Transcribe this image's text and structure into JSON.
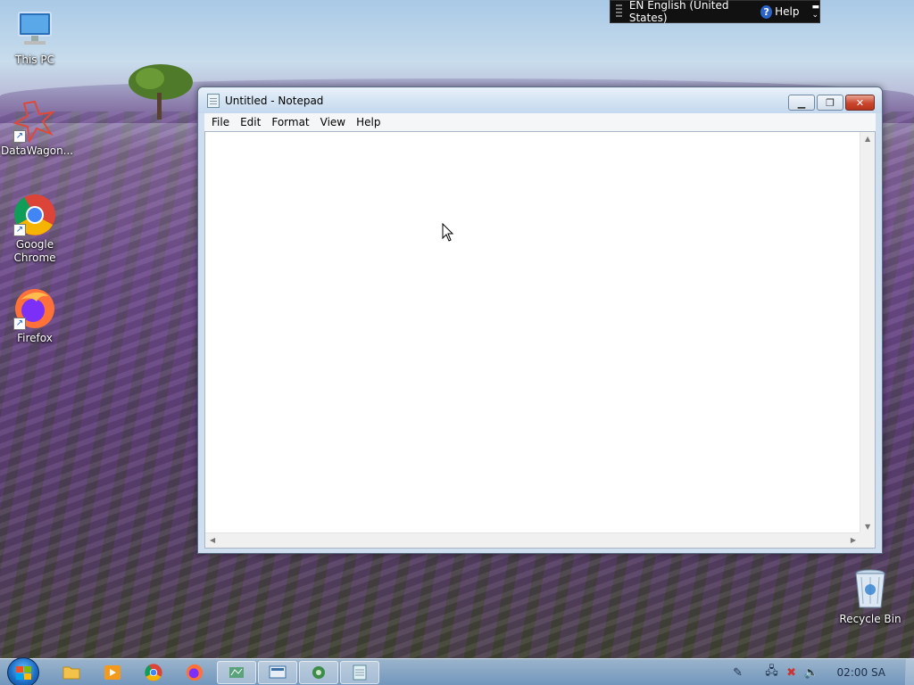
{
  "desktop": {
    "icons": [
      {
        "label": "This PC",
        "icon": "computer-icon"
      },
      {
        "label": "DataWagon...",
        "icon": "datawagon-icon"
      },
      {
        "label": "Google Chrome",
        "icon": "chrome-icon"
      },
      {
        "label": "Firefox",
        "icon": "firefox-icon"
      },
      {
        "label": "Recycle Bin",
        "icon": "recycle-bin-icon"
      }
    ]
  },
  "language_bar": {
    "language": "EN English (United States)",
    "help_label": "Help",
    "help_glyph": "?"
  },
  "notepad": {
    "title": "Untitled - Notepad",
    "menu": [
      "File",
      "Edit",
      "Format",
      "View",
      "Help"
    ],
    "content": ""
  },
  "taskbar": {
    "pinned": [
      "file-explorer-icon",
      "media-player-icon",
      "chrome-icon",
      "firefox-icon",
      "app-icon-1",
      "app-icon-2",
      "app-icon-3",
      "notepad-icon"
    ],
    "clock": "02:00 SA"
  },
  "colors": {
    "close_button": "#c9462c",
    "title_bar": "#d5e4f3",
    "taskbar": "#78a0cd"
  }
}
